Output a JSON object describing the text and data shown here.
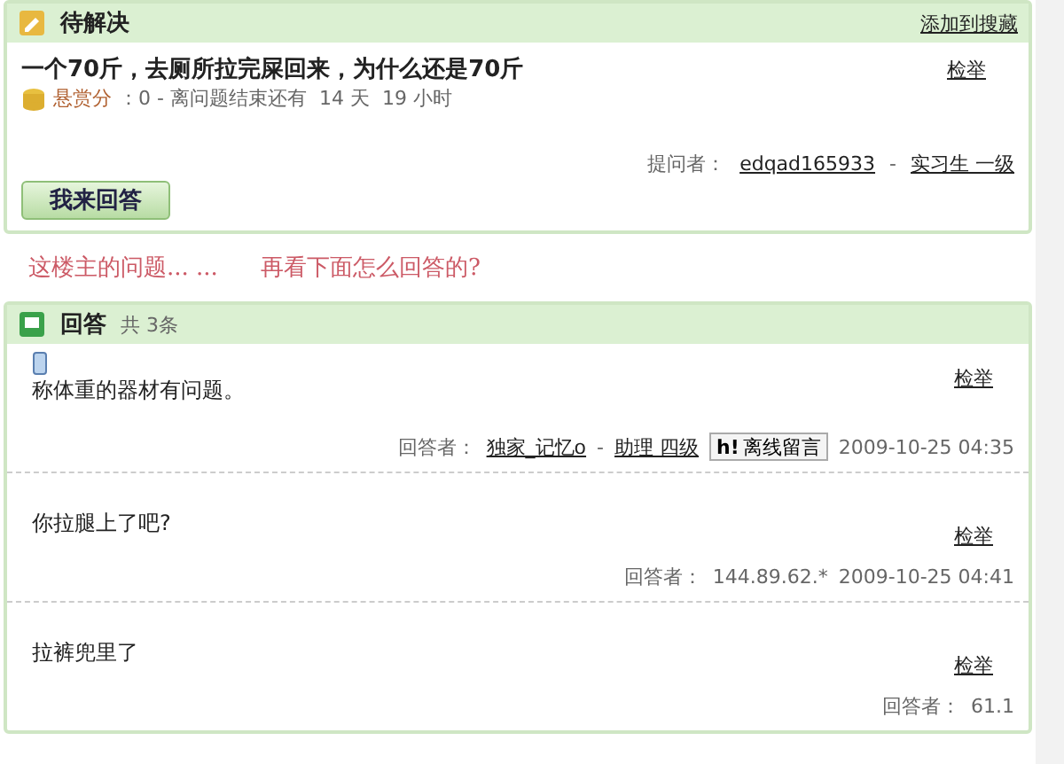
{
  "question": {
    "status": "待解决",
    "add_link": "添加到搜藏",
    "title": "一个70斤，去厕所拉完屎回来，为什么还是70斤",
    "reward_label": "悬赏分",
    "reward_info": "：0 - 离问题结束还有  14 天  19 小时",
    "report": "检举",
    "asker_label": "提问者：",
    "asker": "edqad165933",
    "separator": "-",
    "asker_level": "实习生 一级",
    "answer_button": "我来回答"
  },
  "annotation": [
    "这楼主的问题... ...",
    "再看下面怎么回答的?"
  ],
  "answers": {
    "title": "回答",
    "count": "共 3条",
    "items": [
      {
        "kind": "user",
        "mobile": true,
        "text": "称体重的器材有问题。",
        "report": "检举",
        "answerer_label": "回答者：",
        "answerer": "独家_记忆o",
        "separator": "-",
        "level": "助理 四级",
        "message_icon": "h!",
        "message_button": "离线留言",
        "time": "2009-10-25 04:35"
      },
      {
        "kind": "anonymous",
        "mobile": false,
        "text": "你拉腿上了吧?",
        "report": "检举",
        "answerer_label": "回答者：",
        "answerer": "144.89.62.*",
        "time": "2009-10-25 04:41"
      },
      {
        "kind": "anonymous",
        "mobile": false,
        "text": "拉裤兜里了",
        "report": "检举",
        "answerer_label": "回答者：",
        "answerer": "61.1"
      }
    ]
  }
}
